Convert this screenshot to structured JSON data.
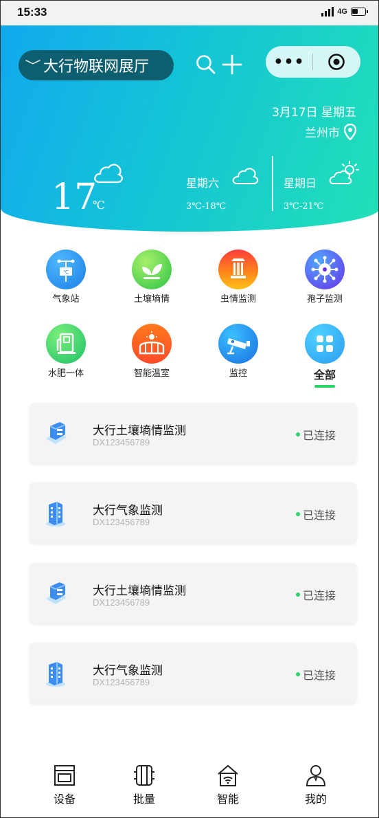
{
  "status_bar": {
    "time": "15:33",
    "network": "4G"
  },
  "header": {
    "location": "大行物联网展厅",
    "date": "3月17日 星期五",
    "city": "兰州市",
    "current_temp": "17",
    "current_unit": "℃",
    "forecast": [
      {
        "day": "星期六",
        "range": "3℃-18℃"
      },
      {
        "day": "星期日",
        "range": "3℃-21℃"
      }
    ]
  },
  "categories": [
    {
      "label": "气象站",
      "icon": "weather-station-icon",
      "color": "#1a8fe8"
    },
    {
      "label": "土壤墒情",
      "icon": "sprout-icon",
      "color": "#4ad24a"
    },
    {
      "label": "虫情监测",
      "icon": "insect-lamp-icon",
      "color": "#ff7a1a"
    },
    {
      "label": "孢子监测",
      "icon": "spore-icon",
      "color": "#5b3df0"
    },
    {
      "label": "水肥一体",
      "icon": "fertilizer-machine-icon",
      "color": "#2ed36a"
    },
    {
      "label": "智能温室",
      "icon": "greenhouse-icon",
      "color": "#ff6a2a"
    },
    {
      "label": "监控",
      "icon": "camera-icon",
      "color": "#1a8fe8"
    },
    {
      "label": "全部",
      "icon": "grid-icon",
      "color": "#3ab6f0"
    }
  ],
  "devices": [
    {
      "name": "大行土壤墒情监测",
      "id": "DX123456789",
      "status": "已连接",
      "icon": "soil-device-icon"
    },
    {
      "name": "大行气象监测",
      "id": "DX123456789",
      "status": "已连接",
      "icon": "weather-device-icon"
    },
    {
      "name": "大行土壤墒情监测",
      "id": "DX123456789",
      "status": "已连接",
      "icon": "soil-device-icon"
    },
    {
      "name": "大行气象监测",
      "id": "DX123456789",
      "status": "已连接",
      "icon": "weather-device-icon"
    }
  ],
  "tabbar": [
    {
      "label": "设备",
      "icon": "device-icon"
    },
    {
      "label": "批量",
      "icon": "batch-icon"
    },
    {
      "label": "智能",
      "icon": "smart-home-icon"
    },
    {
      "label": "我的",
      "icon": "user-icon"
    }
  ],
  "colors": {
    "accent_green": "#2ed36a",
    "hero_start": "#11a9ee",
    "hero_end": "#22e0b7"
  }
}
